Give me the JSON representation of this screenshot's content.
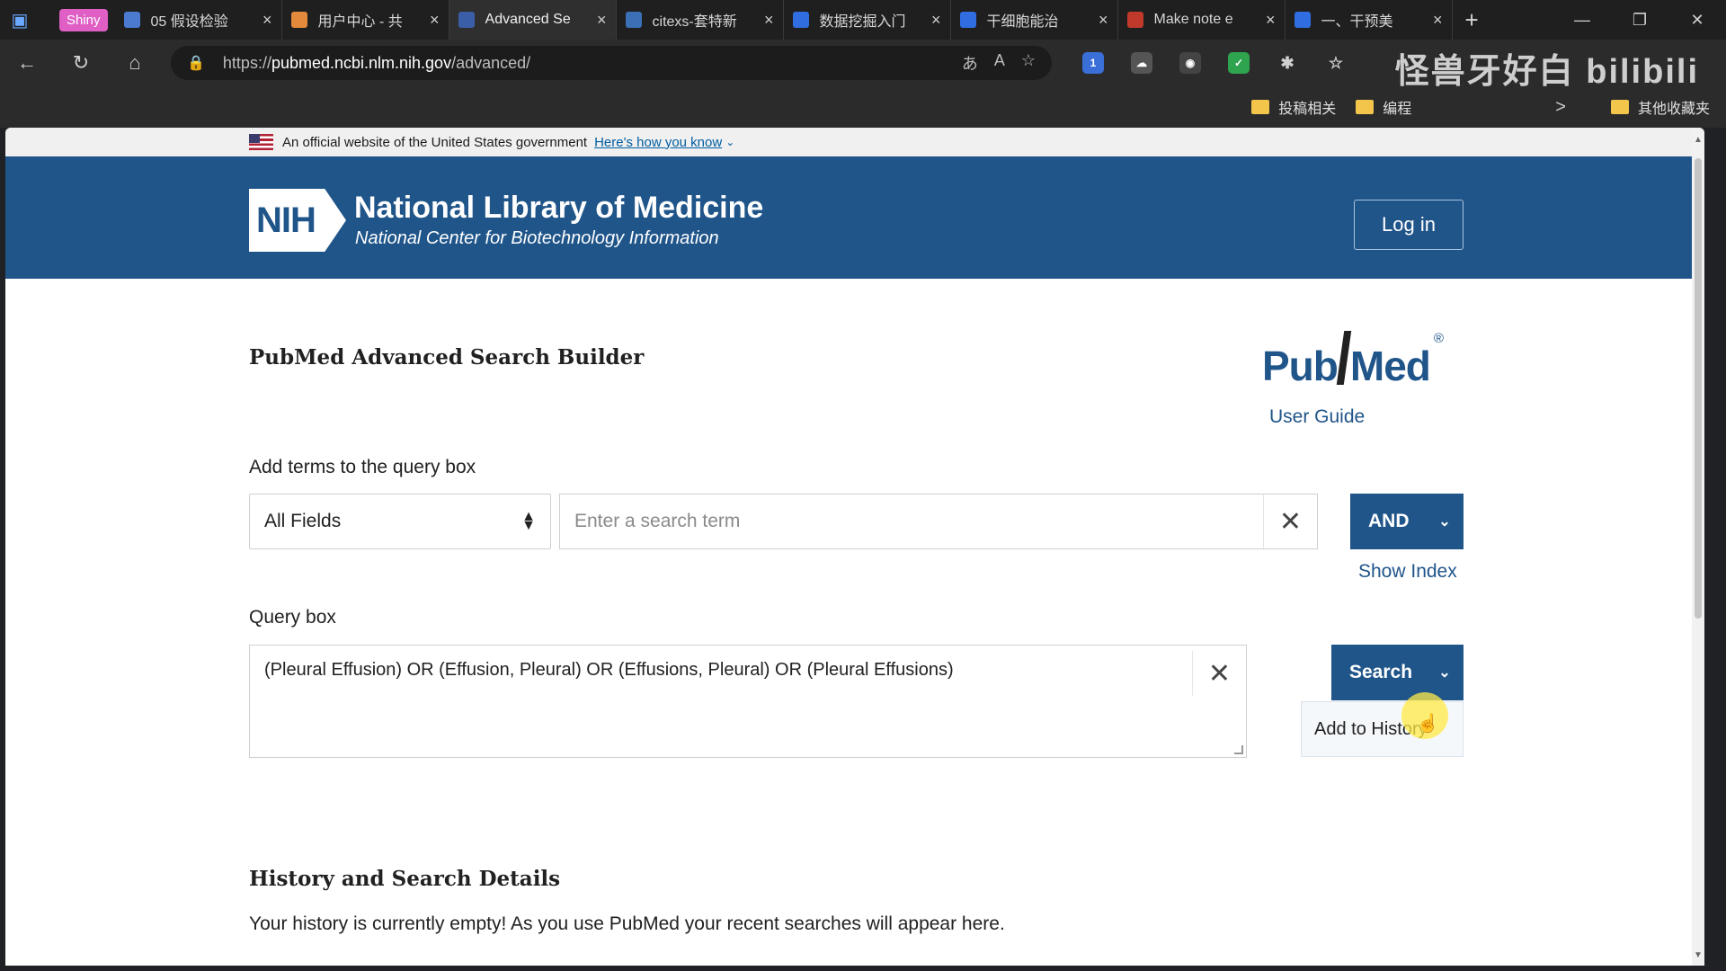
{
  "browser": {
    "tab_pill": "Shiny",
    "tabs": [
      {
        "title": "05 假设检验",
        "icon_color": "#4a7bd0",
        "active": false
      },
      {
        "title": "用户中心 - 共",
        "icon_color": "#e38a3c",
        "active": false
      },
      {
        "title": "Advanced Se",
        "icon_color": "#3a5ea8",
        "active": true
      },
      {
        "title": "citexs-套特新",
        "icon_color": "#3b6fb6",
        "active": false
      },
      {
        "title": "数据挖掘入门",
        "icon_color": "#2f6de1",
        "active": false
      },
      {
        "title": "干细胞能治",
        "icon_color": "#2f6de1",
        "active": false
      },
      {
        "title": "Make note e",
        "icon_color": "#c0392b",
        "active": false
      },
      {
        "title": "一、干预美",
        "icon_color": "#2f6de1",
        "active": false
      }
    ],
    "tab_close": "×",
    "new_tab": "+",
    "url_host": "pubmed.ncbi.nlm.nih.gov",
    "url_prefix": "https://",
    "url_path": "/advanced/",
    "watermark": "怪兽牙好白 bilibili",
    "bookmarks": [
      {
        "label": "投稿相关"
      },
      {
        "label": "编程"
      },
      {
        "label": "其他收藏夹"
      }
    ],
    "bookmark_chevron": ">",
    "extension_badge": "1"
  },
  "gov_banner": {
    "text": "An official website of the United States government",
    "link": "Here's how you know"
  },
  "header": {
    "logo_text": "NIH",
    "title": "National Library of Medicine",
    "subtitle": "National Center for Biotechnology Information",
    "login_label": "Log in"
  },
  "page": {
    "title": "PubMed Advanced Search Builder",
    "logo_pub": "Pub",
    "logo_med": "Med",
    "logo_reg": "®",
    "user_guide": "User Guide",
    "add_terms_label": "Add terms to the query box",
    "field_select_value": "All Fields",
    "search_placeholder": "Enter a search term",
    "and_label": "AND",
    "show_index": "Show Index",
    "query_label": "Query box",
    "query_text": "(Pleural Effusion) OR (Effusion, Pleural) OR (Effusions, Pleural) OR (Pleural Effusions)",
    "search_label": "Search",
    "dropdown_item": "Add to History",
    "history_title": "History and Search Details",
    "history_text": "Your history is currently empty! As you use PubMed your recent searches will appear here."
  },
  "colors": {
    "ncbi_blue": "#20558a",
    "tab_bg": "#1f1f1f",
    "active_tab_bg": "#2f2f2f"
  }
}
